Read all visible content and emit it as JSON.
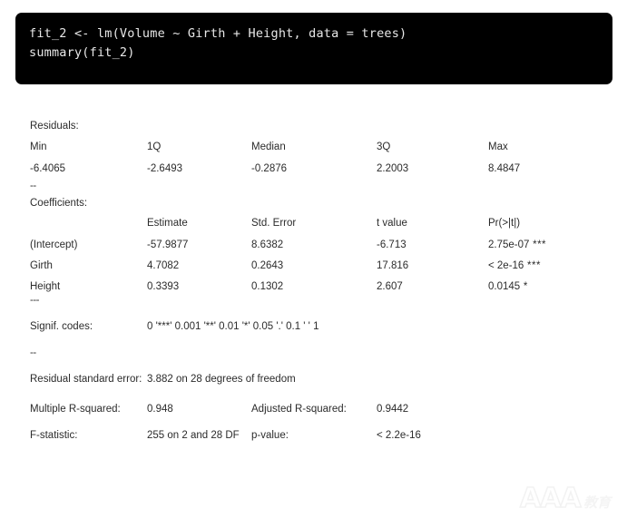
{
  "code_block": {
    "background": "#000000",
    "text_color": "#e8e8e8",
    "lines": [
      "fit_2 <- lm(Volume ~ Girth + Height, data = trees)",
      "summary(fit_2)"
    ],
    "line1": "fit_2 <- lm(Volume ~ Girth + Height, data = trees)",
    "line2": "summary(fit_2)"
  },
  "output": {
    "residuals": {
      "title": "Residuals:",
      "headers": [
        "Min",
        "1Q",
        "Median",
        "3Q",
        "Max"
      ],
      "header_min": "Min",
      "header_1q": "1Q",
      "header_median": "Median",
      "header_3q": "3Q",
      "header_max": "Max",
      "values": [
        "-6.4065",
        "-2.6493",
        "-0.2876",
        "2.2003",
        "8.4847"
      ],
      "value_min": "-6.4065",
      "value_1q": "-2.6493",
      "value_median": "-0.2876",
      "value_3q": "2.2003",
      "value_max": "8.4847"
    },
    "separator_1": "--",
    "coefficients": {
      "title": "Coefficients:",
      "headers": [
        "",
        "Estimate",
        "Std. Error",
        "t value",
        "Pr(>|t|)"
      ],
      "header_estimate": "Estimate",
      "header_std_error": "Std. Error",
      "header_t_value": "t value",
      "header_p_value": "Pr(>|t|)",
      "rows": [
        {
          "term": "(Intercept)",
          "estimate": "-57.9877",
          "std_error": "8.6382",
          "t_value": "-6.713",
          "p_value": "2.75e-07",
          "signif": "***"
        },
        {
          "term": "Girth",
          "estimate": "4.7082",
          "std_error": "0.2643",
          "t_value": "17.816",
          "p_value": "< 2e-16",
          "signif": "***"
        },
        {
          "term": "Height",
          "estimate": "0.3393",
          "std_error": "0.1302",
          "t_value": "2.607",
          "p_value": "0.0145",
          "signif": "*"
        }
      ]
    },
    "separator_2": "---",
    "signif_codes": {
      "label": "Signif. codes:",
      "value": "0 '***' 0.001 '**' 0.01 '*'  0.05 '.' 0.1 ' ' 1"
    },
    "separator_3": "--",
    "residual_standard_error": {
      "label": "Residual standard error:",
      "value": "3.882 on 28 degrees of  freedom"
    },
    "r_squared": {
      "multiple_label": "Multiple R-squared:",
      "multiple_value": "0.948",
      "adjusted_label": "Adjusted R-squared:",
      "adjusted_value": "0.9442"
    },
    "f_statistic": {
      "label": "F-statistic:",
      "value": "255 on 2 and 28 DF",
      "p_label": "p-value:",
      "p_value": "< 2.2e-16"
    }
  },
  "watermark": {
    "text": "AAA",
    "subtext": "教育",
    "color": "#f2f2f2"
  }
}
